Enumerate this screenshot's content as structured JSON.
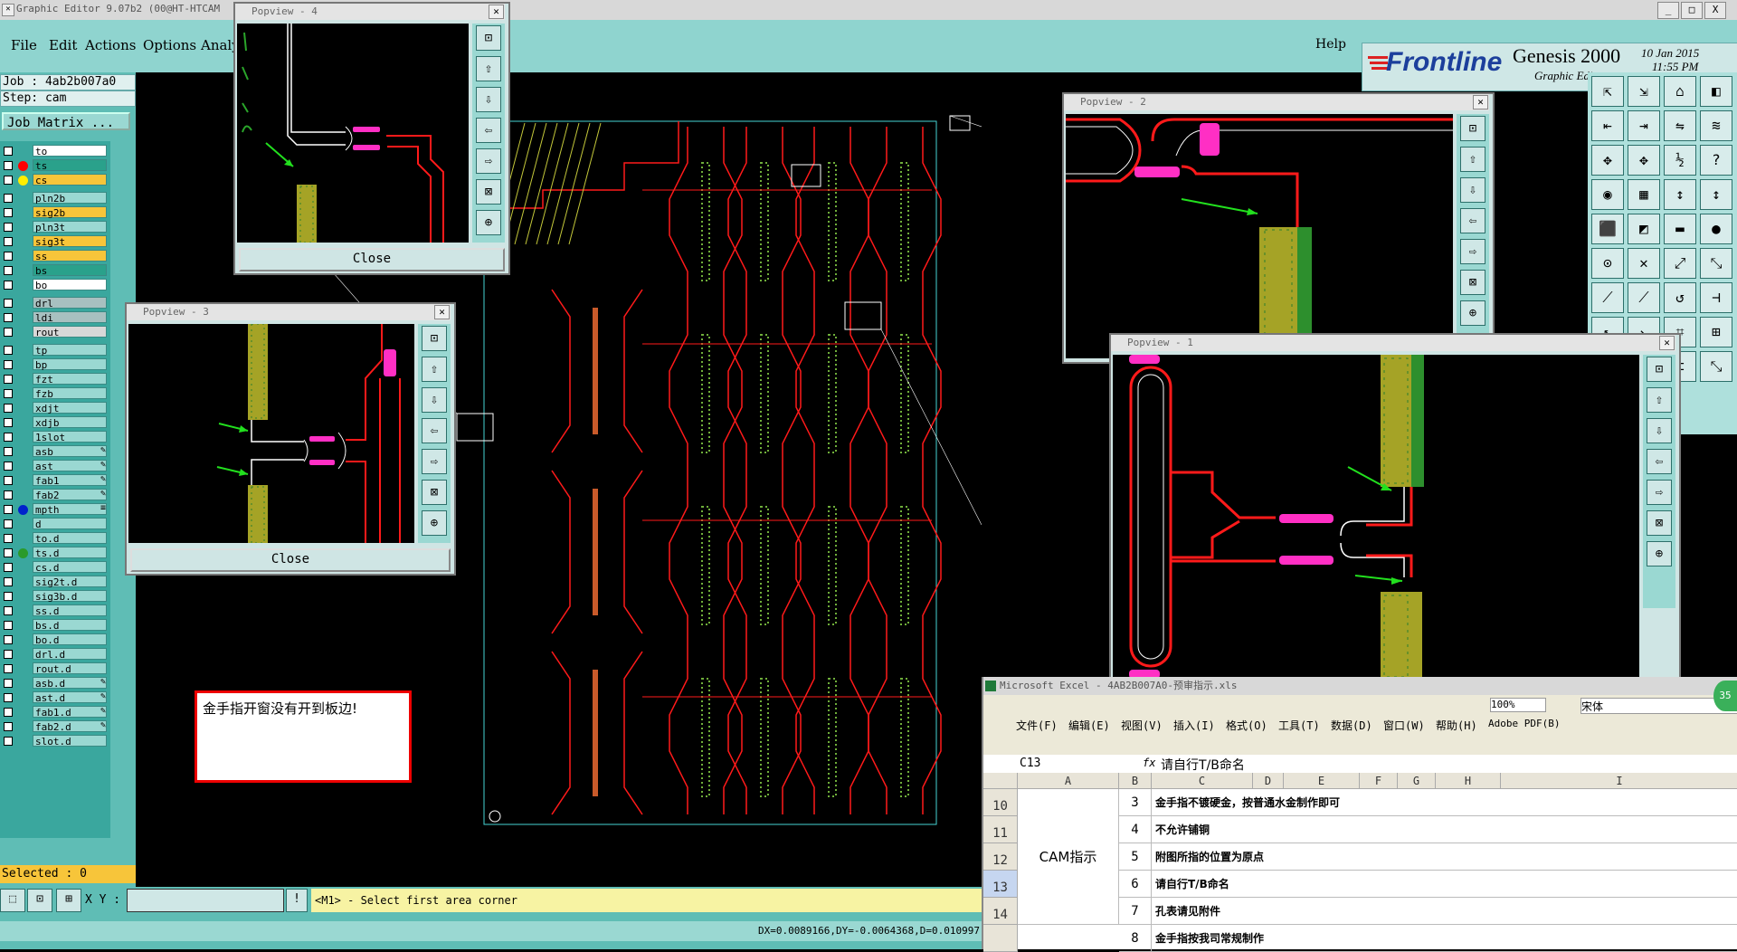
{
  "app": {
    "title": "Graphic Editor 9.07b2  (00@HT-HTCAM",
    "help_label": "Help",
    "brand": "Frontline",
    "product": "Genesis 2000",
    "subtitle": "Graphic Editor",
    "date": "10 Jan 2015",
    "time": "11:55 PM"
  },
  "menu": [
    "File",
    "Edit",
    "Actions",
    "Options",
    "Analy"
  ],
  "job": {
    "job": "Job : 4ab2b007a0",
    "step": "Step: cam",
    "matrix_label": "Job Matrix ..."
  },
  "layers": [
    {
      "name": "to",
      "bg": "#ffffff",
      "dot": ""
    },
    {
      "name": "ts",
      "bg": "#2aa18b",
      "dot": "#ff0000"
    },
    {
      "name": "cs",
      "bg": "#f7c53a",
      "dot": "#ffee00"
    },
    {
      "name": "pln2b",
      "bg": "#9ad8d2",
      "dot": ""
    },
    {
      "name": "sig2b",
      "bg": "#f7c53a",
      "dot": ""
    },
    {
      "name": "pln3t",
      "bg": "#9ad8d2",
      "dot": ""
    },
    {
      "name": "sig3t",
      "bg": "#f7c53a",
      "dot": ""
    },
    {
      "name": "ss",
      "bg": "#f7c53a",
      "dot": ""
    },
    {
      "name": "bs",
      "bg": "#2aa18b",
      "dot": ""
    },
    {
      "name": "bo",
      "bg": "#ffffff",
      "dot": ""
    },
    {
      "name": "drl",
      "bg": "#a8c0c0",
      "dot": ""
    },
    {
      "name": "ldi",
      "bg": "#a8c0c0",
      "dot": ""
    },
    {
      "name": "rout",
      "bg": "#d8d8d8",
      "dot": ""
    },
    {
      "name": "tp",
      "bg": "#9ad8d2",
      "dot": ""
    },
    {
      "name": "bp",
      "bg": "#9ad8d2",
      "dot": ""
    },
    {
      "name": "fzt",
      "bg": "#9ad8d2",
      "dot": ""
    },
    {
      "name": "fzb",
      "bg": "#9ad8d2",
      "dot": ""
    },
    {
      "name": "xdjt",
      "bg": "#9ad8d2",
      "dot": ""
    },
    {
      "name": "xdjb",
      "bg": "#9ad8d2",
      "dot": ""
    },
    {
      "name": "1slot",
      "bg": "#9ad8d2",
      "dot": ""
    },
    {
      "name": "asb",
      "bg": "#9ad8d2",
      "dot": "",
      "feat": "✎"
    },
    {
      "name": "ast",
      "bg": "#9ad8d2",
      "dot": "",
      "feat": "✎"
    },
    {
      "name": "fab1",
      "bg": "#9ad8d2",
      "dot": "",
      "feat": "✎"
    },
    {
      "name": "fab2",
      "bg": "#9ad8d2",
      "dot": "",
      "feat": "✎"
    },
    {
      "name": "mpth",
      "bg": "#9ad8d2",
      "dot": "#0022cc",
      "feat": "≡"
    },
    {
      "name": "d",
      "bg": "#9ad8d2",
      "dot": ""
    },
    {
      "name": "to.d",
      "bg": "#9ad8d2",
      "dot": ""
    },
    {
      "name": "ts.d",
      "bg": "#9ad8d2",
      "dot": "#2a9a2a"
    },
    {
      "name": "cs.d",
      "bg": "#9ad8d2",
      "dot": ""
    },
    {
      "name": "sig2t.d",
      "bg": "#9ad8d2",
      "dot": ""
    },
    {
      "name": "sig3b.d",
      "bg": "#9ad8d2",
      "dot": ""
    },
    {
      "name": "ss.d",
      "bg": "#9ad8d2",
      "dot": ""
    },
    {
      "name": "bs.d",
      "bg": "#9ad8d2",
      "dot": ""
    },
    {
      "name": "bo.d",
      "bg": "#9ad8d2",
      "dot": ""
    },
    {
      "name": "drl.d",
      "bg": "#9ad8d2",
      "dot": ""
    },
    {
      "name": "rout.d",
      "bg": "#9ad8d2",
      "dot": ""
    },
    {
      "name": "asb.d",
      "bg": "#9ad8d2",
      "dot": "",
      "feat": "✎"
    },
    {
      "name": "ast.d",
      "bg": "#9ad8d2",
      "dot": "",
      "feat": "✎"
    },
    {
      "name": "fab1.d",
      "bg": "#9ad8d2",
      "dot": "",
      "feat": "✎"
    },
    {
      "name": "fab2.d",
      "bg": "#9ad8d2",
      "dot": "",
      "feat": "✎"
    },
    {
      "name": "slot.d",
      "bg": "#9ad8d2",
      "dot": ""
    }
  ],
  "selected": "Selected : 0",
  "status": {
    "xy_label": "X Y :",
    "xy_value": "",
    "prompt": "<M1> - Select first area corner",
    "coords": "DX=0.0089166,DY=-0.0064368,D=0.010997"
  },
  "note": "金手指开窗没有开到板边!",
  "popviews": {
    "p4": {
      "title": "Popview - 4",
      "close": "Close"
    },
    "p3": {
      "title": "Popview - 3",
      "close": "Close"
    },
    "p2": {
      "title": "Popview - 2"
    },
    "p1": {
      "title": "Popview - 1"
    }
  },
  "window_controls": {
    "min": "_",
    "max": "□",
    "close": "X"
  },
  "excel": {
    "title": "Microsoft Excel - 4AB2B007A0-预审指示.xls",
    "menu": [
      "文件(F)",
      "编辑(E)",
      "视图(V)",
      "插入(I)",
      "格式(O)",
      "工具(T)",
      "数据(D)",
      "窗口(W)",
      "帮助(H)",
      "Adobe PDF(B)"
    ],
    "zoom": "100%",
    "font": "宋体",
    "cell_ref": "C13",
    "fx": "fx",
    "formula": "请自行T/B命名",
    "columns": [
      "A",
      "B",
      "C",
      "D",
      "E",
      "F",
      "G",
      "H",
      "I"
    ],
    "rows": [
      {
        "row": "10",
        "b": "3",
        "c": "金手指不镀硬金，按普通水金制作即可"
      },
      {
        "row": "11",
        "b": "4",
        "c": "不允许铺铜"
      },
      {
        "row": "12",
        "b": "5",
        "c": "附图所指的位置为原点"
      },
      {
        "row": "13",
        "b": "6",
        "c": "请自行T/B命名"
      },
      {
        "row": "14",
        "b": "7",
        "c": "孔表请见附件"
      },
      {
        "row": "",
        "b": "8",
        "c": "金手指按我司常规制作"
      }
    ],
    "merged_a": "CAM指示",
    "bubble": "35"
  },
  "colors": {
    "teal": "#5fbdb5",
    "light_teal": "#9ad8d2",
    "trace_red": "#ff1a1a",
    "pad_magenta": "#ff2fc4",
    "gold": "#a5a326",
    "arrow_green": "#22e01e"
  }
}
